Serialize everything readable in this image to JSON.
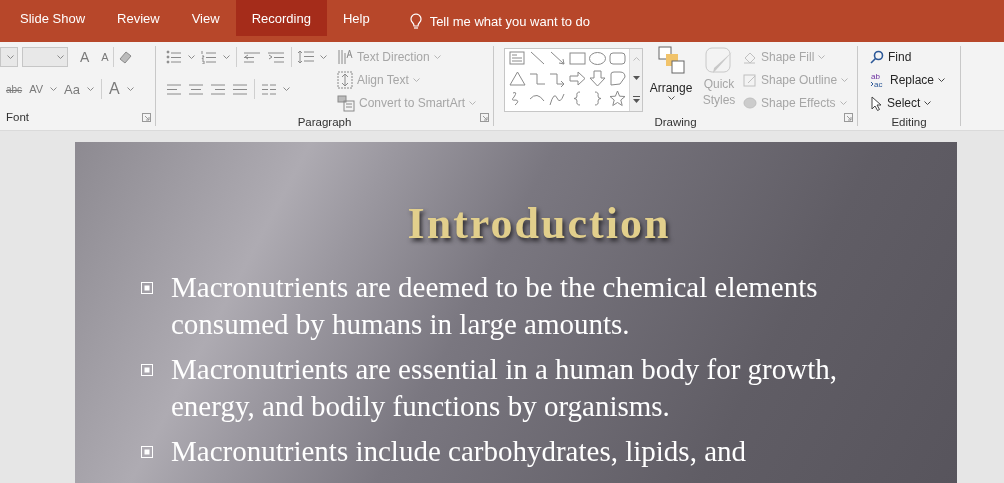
{
  "menu_tabs": [
    {
      "label": "Slide Show",
      "selected": false
    },
    {
      "label": "Review",
      "selected": false
    },
    {
      "label": "View",
      "selected": false
    },
    {
      "label": "Recording",
      "selected": true
    },
    {
      "label": "Help",
      "selected": false
    }
  ],
  "tell_me": {
    "placeholder": "Tell me what you want to do"
  },
  "ribbon": {
    "font": {
      "label": "Font",
      "grow_glyph": "A",
      "shrink_glyph": "A",
      "strike_glyph": "abc",
      "spacing_glyph": "AV",
      "case_glyph": "Aa",
      "color_glyph": "A"
    },
    "paragraph": {
      "label": "Paragraph",
      "commands": [
        {
          "label": "Text Direction",
          "disabled": true
        },
        {
          "label": "Align Text",
          "disabled": true
        },
        {
          "label": "Convert to SmartArt",
          "disabled": true
        }
      ]
    },
    "drawing": {
      "label": "Drawing",
      "arrange": "Arrange",
      "quick_styles": {
        "label": "Quick Styles",
        "disabled": true
      },
      "commands": [
        {
          "label": "Shape Fill",
          "disabled": true
        },
        {
          "label": "Shape Outline",
          "disabled": true
        },
        {
          "label": "Shape Effects",
          "disabled": true
        }
      ]
    },
    "editing": {
      "label": "Editing",
      "commands": [
        {
          "kind": "find",
          "label": "Find"
        },
        {
          "kind": "replace",
          "label": "Replace",
          "icon_glyphs": [
            "ab",
            "ac"
          ]
        },
        {
          "kind": "select",
          "label": "Select"
        }
      ]
    }
  },
  "slide": {
    "title": "Introduction",
    "bullets": [
      "Macronutrients are deemed to be the chemical elements consumed by humans in large amounts.",
      "Macronutrients are essential in a human body for growth, energy, and bodily functions by organisms.",
      "Macronutrients include carbohydrates, lipids, and"
    ]
  }
}
